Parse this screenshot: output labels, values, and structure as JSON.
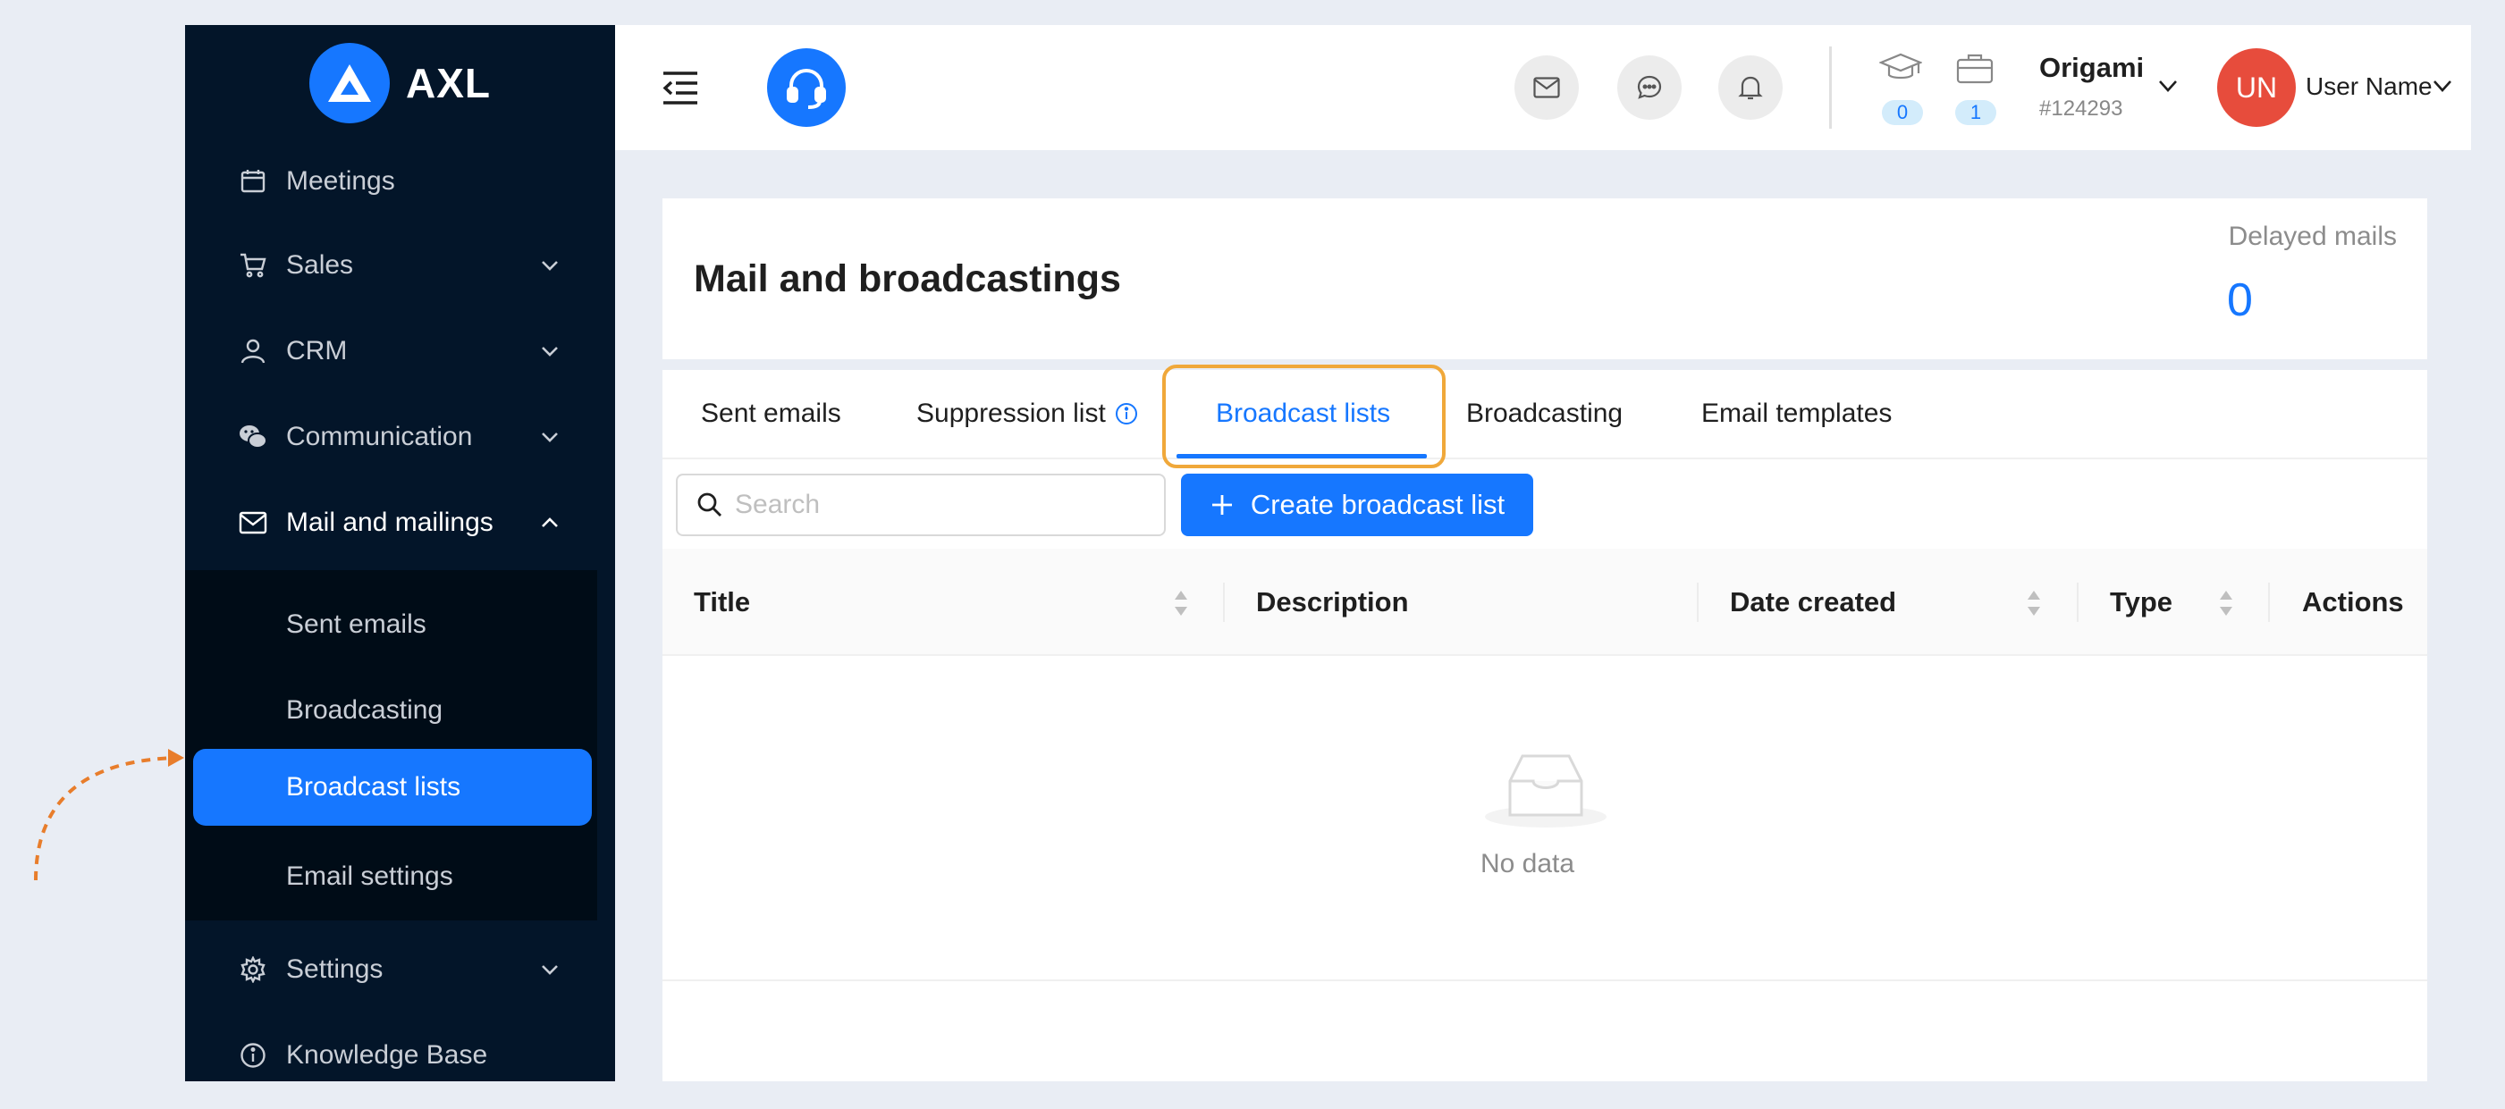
{
  "brand": {
    "name": "AXL"
  },
  "sidebar": {
    "items": [
      {
        "label": "Meetings",
        "icon": "calendar-icon"
      },
      {
        "label": "Sales",
        "icon": "cart-icon"
      },
      {
        "label": "CRM",
        "icon": "user-icon"
      },
      {
        "label": "Communication",
        "icon": "wechat-icon"
      },
      {
        "label": "Mail and mailings",
        "icon": "mail-icon"
      },
      {
        "label": "Settings",
        "icon": "gear-icon"
      },
      {
        "label": "Knowledge Base",
        "icon": "info-icon"
      }
    ],
    "submenu": [
      {
        "label": "Sent emails"
      },
      {
        "label": "Broadcasting"
      },
      {
        "label": "Broadcast lists"
      },
      {
        "label": "Email settings"
      }
    ],
    "active_item": "Broadcast lists"
  },
  "header": {
    "badges": {
      "courses": "0",
      "cases": "1"
    },
    "org": {
      "name": "Origami",
      "id": "#124293"
    },
    "user": {
      "initials": "UN",
      "name": "User Name"
    }
  },
  "page": {
    "title": "Mail and broadcastings",
    "delayed_label": "Delayed mails",
    "delayed_value": "0"
  },
  "tabs": [
    {
      "label": "Sent emails"
    },
    {
      "label": "Suppression list"
    },
    {
      "label": "Broadcast lists"
    },
    {
      "label": "Broadcasting"
    },
    {
      "label": "Email templates"
    }
  ],
  "active_tab": "Broadcast lists",
  "toolbar": {
    "search_placeholder": "Search",
    "create_label": "Create broadcast list"
  },
  "table": {
    "columns": [
      "Title",
      "Description",
      "Date created",
      "Type",
      "Actions"
    ],
    "rows": [],
    "empty_text": "No data"
  },
  "colors": {
    "primary": "#1677ff",
    "sidebar_bg": "#031529",
    "submenu_bg": "#000c17",
    "avatar_bg": "#e74c3c",
    "highlight_border": "#f0a83a"
  }
}
